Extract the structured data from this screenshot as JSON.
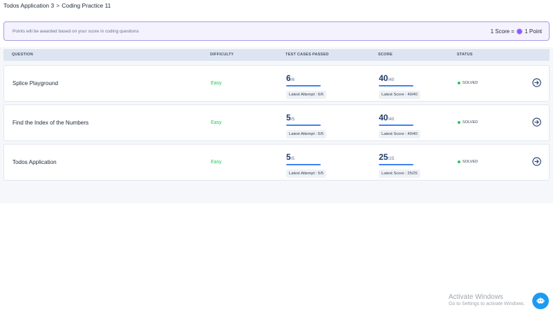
{
  "breadcrumb": {
    "parent": "Todos Application 3",
    "separator": ">",
    "current": "Coding Practice 11"
  },
  "banner": {
    "note": "Points will be awarded based on your score in coding questions",
    "rate_left": "1 Score =",
    "rate_right": "1 Point",
    "coin_icon": "coin-icon"
  },
  "table": {
    "headers": {
      "question": "QUESTION",
      "difficulty": "DIFFICULTY",
      "tests": "TEST CASES PASSED",
      "score": "SCORE",
      "status": "STATUS"
    },
    "rows": [
      {
        "title": "Splice Playground",
        "difficulty": "Easy",
        "tests_passed": "6",
        "tests_total": "/6",
        "latest_attempt": "Latest Attempt : 6/6",
        "score": "40",
        "score_total": "/40",
        "latest_score": "Latest Score : 40/40",
        "status": "SOLVED"
      },
      {
        "title": "Find the Index of the Numbers",
        "difficulty": "Easy",
        "tests_passed": "5",
        "tests_total": "/5",
        "latest_attempt": "Latest Attempt : 5/5",
        "score": "40",
        "score_total": "/40",
        "latest_score": "Latest Score : 40/40",
        "status": "SOLVED"
      },
      {
        "title": "Todos Application",
        "difficulty": "Easy",
        "tests_passed": "5",
        "tests_total": "/5",
        "latest_attempt": "Latest Attempt : 5/5",
        "score": "25",
        "score_total": "/25",
        "latest_score": "Latest Score : 25/25",
        "status": "SOLVED"
      }
    ]
  },
  "watermark": {
    "line1": "Activate Windows",
    "line2": "Go to Settings to activate Windows."
  },
  "colors": {
    "accent": "#3b82f6",
    "easy": "#22c55e",
    "solved": "#22c55e",
    "banner_border": "#a99be8",
    "fab": "#1d9bf0"
  }
}
